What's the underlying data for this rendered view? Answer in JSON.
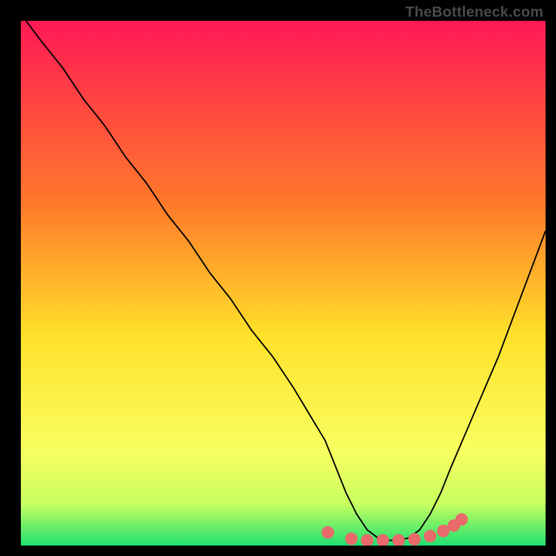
{
  "watermark": "TheBottleneck.com",
  "chart_data": {
    "type": "line",
    "title": "",
    "xlabel": "",
    "ylabel": "",
    "xlim": [
      0,
      100
    ],
    "ylim": [
      0,
      100
    ],
    "gradient_stops": [
      {
        "offset": 0,
        "color": "#ff1a55"
      },
      {
        "offset": 35,
        "color": "#ff7a2a"
      },
      {
        "offset": 60,
        "color": "#ffe12a"
      },
      {
        "offset": 82,
        "color": "#f8ff60"
      },
      {
        "offset": 92,
        "color": "#c8ff60"
      },
      {
        "offset": 100,
        "color": "#20e070"
      }
    ],
    "series": [
      {
        "name": "curve",
        "color": "#000000",
        "x": [
          1,
          4,
          8,
          12,
          16,
          20,
          24,
          28,
          32,
          36,
          40,
          44,
          48,
          52,
          55,
          58,
          60,
          62,
          64,
          66,
          68,
          70,
          72,
          74,
          76,
          78,
          80,
          82,
          85,
          88,
          91,
          94,
          97,
          100
        ],
        "y": [
          100,
          96,
          91,
          85,
          80,
          74,
          69,
          63,
          58,
          52,
          47,
          41,
          36,
          30,
          25,
          20,
          15,
          10,
          6,
          3,
          1.5,
          1,
          1,
          1.5,
          3,
          6,
          10,
          15,
          22,
          29,
          36,
          44,
          52,
          60
        ]
      },
      {
        "name": "highlight-dots",
        "color": "#e86a6a",
        "type": "scatter",
        "x": [
          58.5,
          63,
          66,
          69,
          72,
          75,
          78,
          80.5,
          82.5,
          84
        ],
        "y": [
          2.5,
          1.3,
          1,
          1,
          1,
          1.2,
          1.8,
          2.8,
          3.8,
          5
        ]
      }
    ]
  }
}
